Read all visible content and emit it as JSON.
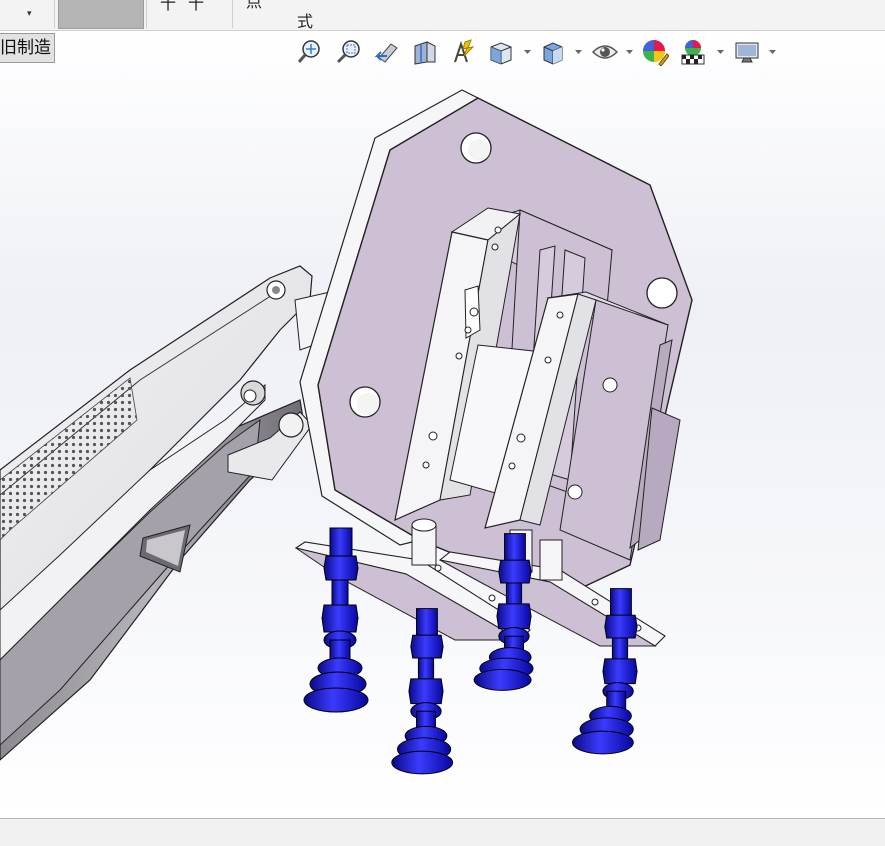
{
  "ribbon": {
    "dropdown_arrow": "▾",
    "partial_text_1": "十",
    "partial_text_2": "点",
    "partial_text_3": "式"
  },
  "tab": {
    "label": "旧制造"
  },
  "heads_up_toolbar": {
    "tools": [
      {
        "name": "zoom-to-fit-icon"
      },
      {
        "name": "zoom-to-area-icon"
      },
      {
        "name": "previous-view-icon"
      },
      {
        "name": "section-view-icon"
      },
      {
        "name": "dynamic-annotation-views-icon"
      },
      {
        "name": "view-orientation-icon"
      },
      {
        "name": "display-style-icon"
      },
      {
        "name": "hide-show-items-icon"
      },
      {
        "name": "edit-appearance-icon"
      },
      {
        "name": "apply-scene-icon"
      },
      {
        "name": "view-settings-icon"
      }
    ]
  },
  "colors": {
    "plate_face": "#cdbfd4",
    "suction_cup_blue": "#1a1adc",
    "background_top": "#ffffff",
    "background_mid": "#eef0f6"
  }
}
